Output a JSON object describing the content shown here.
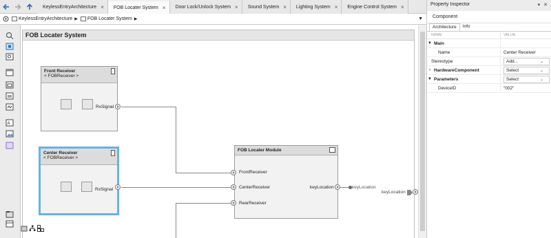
{
  "tabs": [
    {
      "label": "KeylessEntryArchitecture",
      "active": false
    },
    {
      "label": "FOB Locater System",
      "active": true
    },
    {
      "label": "Door Lock/Unlock System",
      "active": false
    },
    {
      "label": "Sound System",
      "active": false
    },
    {
      "label": "Lighting System",
      "active": false
    },
    {
      "label": "Engine Control System",
      "active": false
    }
  ],
  "breadcrumb": [
    {
      "label": "KeylessEntryArchitecture"
    },
    {
      "label": "FOB Locater System"
    }
  ],
  "canvas": {
    "system_title": "FOB Locater System",
    "front_receiver": {
      "name": "Front Receiver",
      "stereotype": "< FOBReceiver >",
      "port": "RxSignal"
    },
    "center_receiver": {
      "name": "Center Receiver",
      "stereotype": "< FOBReceiver >",
      "port": "RxSignal"
    },
    "module": {
      "name": "FOB Locater Module",
      "in_ports": [
        "FrontReceiver",
        "CenterReceiver",
        "RearReceiver"
      ],
      "out_port": "keyLocation",
      "wire_label": "keyLocation",
      "root_out_port": "keyLocation"
    }
  },
  "inspector": {
    "title": "Property Inspector",
    "section": "Component",
    "tabs": [
      "Architecture",
      "Info"
    ],
    "active_tab": "Architecture",
    "col_name": "NAME",
    "col_value": "VALUE",
    "rows": [
      {
        "key": "Main",
        "type": "group",
        "expanded": true
      },
      {
        "key": "Name",
        "value": "Center Receiver",
        "indent": 2
      },
      {
        "key": "Stereotype",
        "value": "Add...",
        "dropdown": true,
        "indent": 1
      },
      {
        "key": "HardwareComponent",
        "value": "Select",
        "type": "group",
        "dropdown": true,
        "expanded": false
      },
      {
        "key": "Parameters",
        "value": "Select",
        "type": "group",
        "dropdown": true,
        "expanded": true
      },
      {
        "key": "DeviceID",
        "value": "\"002\"",
        "indent": 2
      }
    ]
  },
  "colors": {
    "selection": "#66b2e6",
    "component_fill": "#f2f2f2",
    "header_fill": "#dcdcdc",
    "wire": "#888888"
  }
}
